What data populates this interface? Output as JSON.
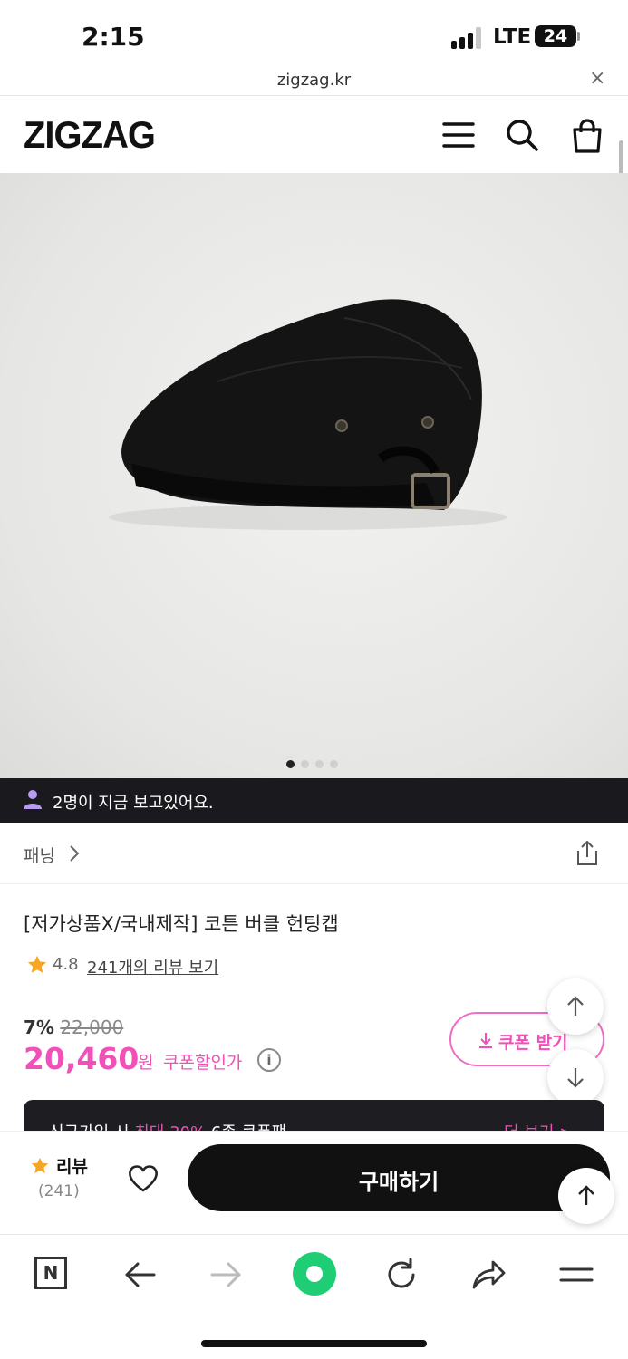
{
  "status_bar": {
    "time": "2:15",
    "network": "LTE",
    "battery": "24"
  },
  "browser": {
    "url": "zigzag.kr",
    "close_glyph": "×"
  },
  "header": {
    "logo": "ZIGZAG",
    "icons": [
      "menu-icon",
      "search-icon",
      "cart-icon"
    ]
  },
  "gallery": {
    "page_count": 4,
    "active_page": 1
  },
  "viewers": {
    "text": "2명이 지금 보고있어요."
  },
  "breadcrumb": {
    "shop": "패닝"
  },
  "product": {
    "title": "[저가상품X/국내제작] 코튼 버클 헌팅캡",
    "rating": "4.8",
    "review_link": "241개의 리뷰 보기",
    "discount_rate": "7%",
    "original_price": "22,000",
    "price": "20,460",
    "price_unit": "원",
    "coupon_price_label": "쿠폰할인가",
    "info_glyph": "i",
    "coupon_button": "쿠폰 받기"
  },
  "banner": {
    "text_prefix": "신규가입 시 ",
    "text_highlight": "최대 30%",
    "text_suffix": " 6종 쿠폰팩",
    "more": "더 보기 >"
  },
  "action_bar": {
    "review_label": "리뷰",
    "review_count": "(241)",
    "buy_button": "구매하기"
  },
  "colors": {
    "accent": "#f050b8",
    "dark": "#111111",
    "green": "#1fce74",
    "star": "#f5a623"
  }
}
